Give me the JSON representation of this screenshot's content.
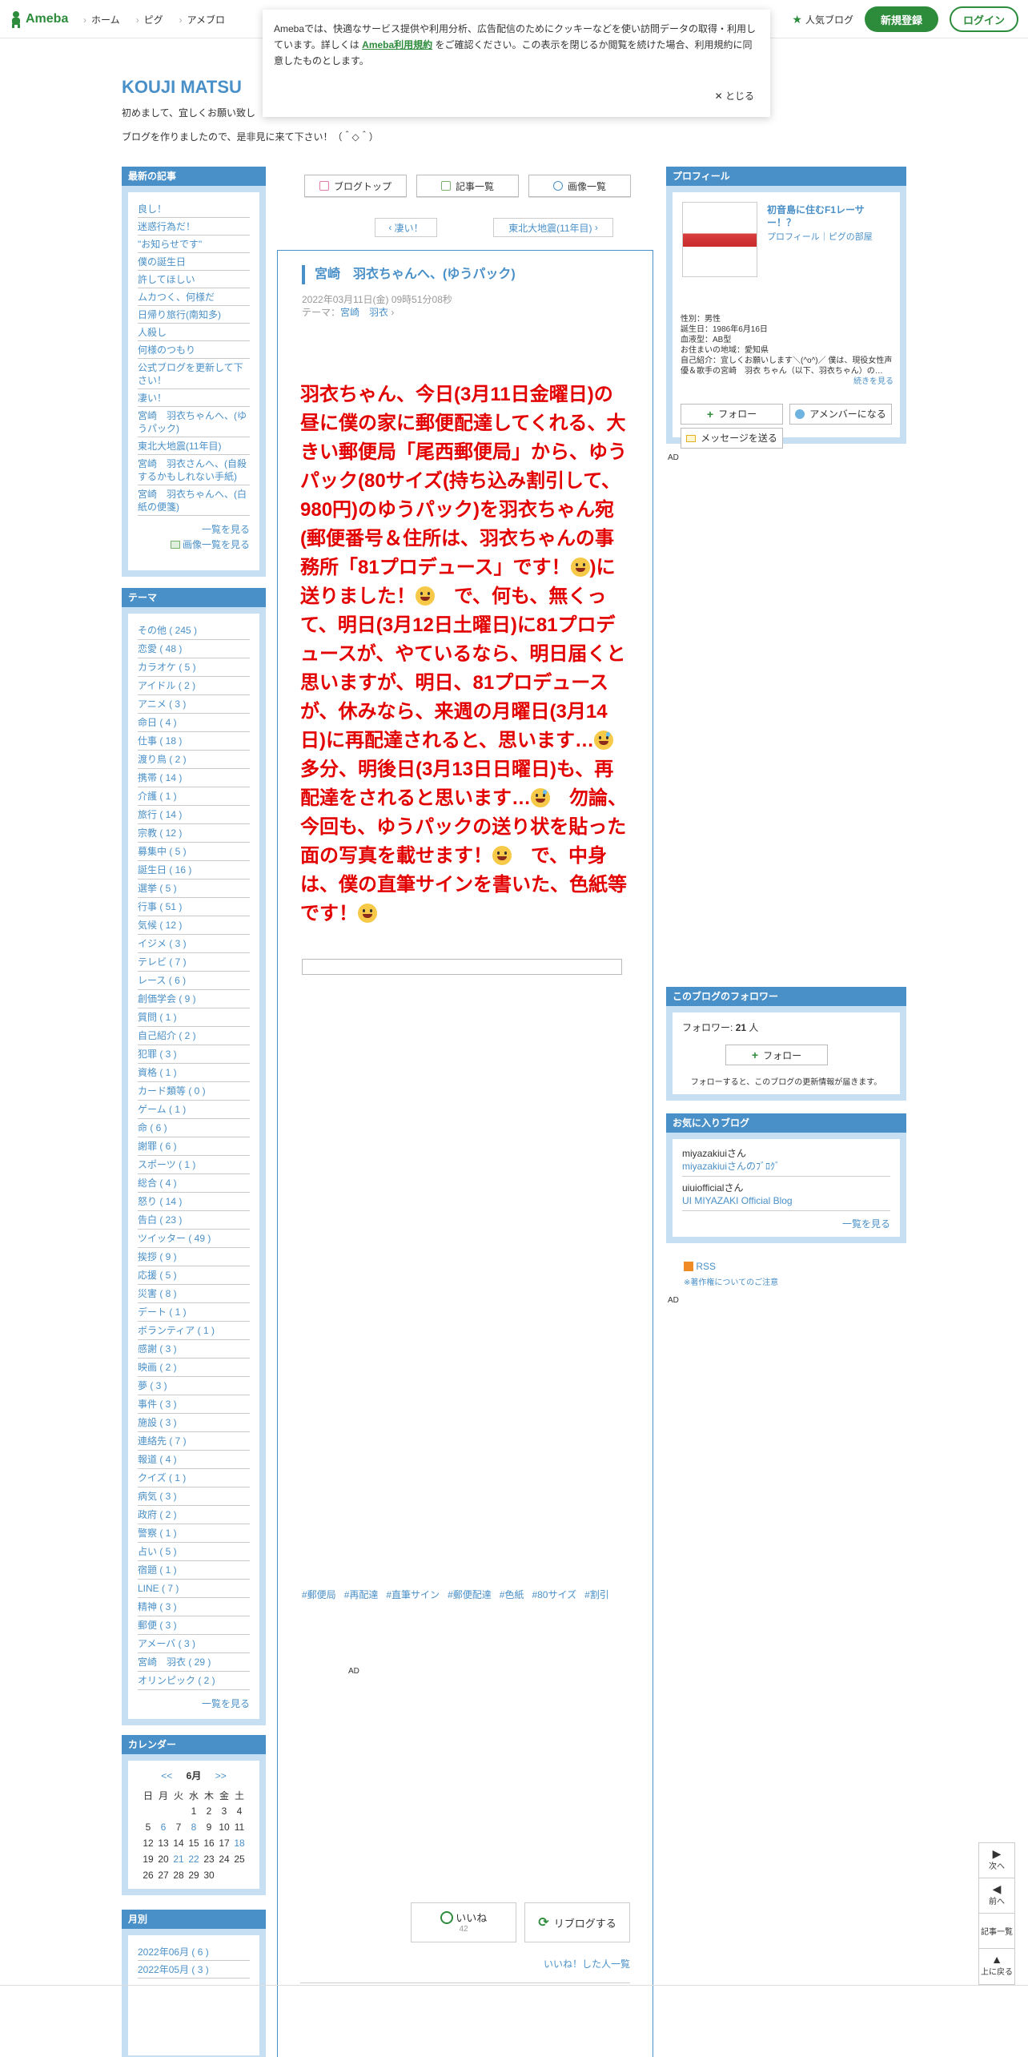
{
  "topbar": {
    "logo": "Ameba",
    "nav": [
      "ホーム",
      "ピグ",
      "アメブロ"
    ],
    "popular": "人気ブログ",
    "register": "新規登録",
    "login": "ログイン"
  },
  "cookie": {
    "text1": "Amebaでは、快適なサービス提供や利用分析、広告配信のためにクッキーなどを使い訪問データの取得・利用しています。詳しくは",
    "link": "Ameba利用規約",
    "text2": "をご確認ください。この表示を閉じるか閲覧を続けた場合、利用規約に同意したものとします。",
    "close": "とじる"
  },
  "blog": {
    "title": "KOUJI MATSU",
    "desc1": "初めまして、宜しくお願い致し",
    "desc2": "ブログを作りましたので、是非見に来て下さい！（＾◇＾）"
  },
  "recent": {
    "header": "最新の記事",
    "items": [
      "良し！",
      "迷惑行為だ！",
      "\"お知らせです\"",
      "僕の誕生日",
      "許してほしい",
      "ムカつく、何様だ",
      "日帰り旅行(南知多)",
      "人殺し",
      "何様のつもり",
      "公式ブログを更新して下さい！",
      "凄い！",
      "宮崎　羽衣ちゃんへ、(ゆうパック)",
      "東北大地震(11年目)",
      "宮崎　羽衣さんへ、(自殺するかもしれない手紙)",
      "宮崎　羽衣ちゃんへ、(白紙の便箋)"
    ],
    "more": "一覧を見る",
    "image_more": "画像一覧を見る"
  },
  "themes": {
    "header": "テーマ",
    "items": [
      "その他 ( 245 )",
      "恋愛 ( 48 )",
      "カラオケ ( 5 )",
      "アイドル ( 2 )",
      "アニメ ( 3 )",
      "命日 ( 4 )",
      "仕事 ( 18 )",
      "渡り鳥 ( 2 )",
      "携帯 ( 14 )",
      "介護 ( 1 )",
      "旅行 ( 14 )",
      "宗教 ( 12 )",
      "募集中 ( 5 )",
      "誕生日 ( 16 )",
      "選挙 ( 5 )",
      "行事 ( 51 )",
      "気候 ( 12 )",
      "イジメ ( 3 )",
      "テレビ ( 7 )",
      "レース ( 6 )",
      "創価学会 ( 9 )",
      "質問 ( 1 )",
      "自己紹介 ( 2 )",
      "犯罪 ( 3 )",
      "資格 ( 1 )",
      "カード類等 ( 0 )",
      "ゲーム ( 1 )",
      "命 ( 6 )",
      "謝罪 ( 6 )",
      "スポーツ ( 1 )",
      "総合 ( 4 )",
      "怒り ( 14 )",
      "告白 ( 23 )",
      "ツイッター ( 49 )",
      "挨拶 ( 9 )",
      "応援 ( 5 )",
      "災害 ( 8 )",
      "デート ( 1 )",
      "ボランティア ( 1 )",
      "感謝 ( 3 )",
      "映画 ( 2 )",
      "夢 ( 3 )",
      "事件 ( 3 )",
      "施設 ( 3 )",
      "連絡先 ( 7 )",
      "報道 ( 4 )",
      "クイズ ( 1 )",
      "病気 ( 3 )",
      "政府 ( 2 )",
      "警察 ( 1 )",
      "占い ( 5 )",
      "宿題 ( 1 )",
      "LINE ( 7 )",
      "精神 ( 3 )",
      "郵便 ( 3 )",
      "アメーバ ( 3 )",
      "宮崎　羽衣 ( 29 )",
      "オリンピック ( 2 )"
    ],
    "more": "一覧を見る"
  },
  "calendar": {
    "header": "カレンダー",
    "prev": "<<",
    "month": "6月",
    "next": ">>",
    "weekdays": [
      "日",
      "月",
      "火",
      "水",
      "木",
      "金",
      "土"
    ],
    "rows": [
      [
        "",
        "",
        "",
        "1",
        "2",
        "3",
        "4"
      ],
      [
        "5",
        "6",
        "7",
        "8",
        "9",
        "10",
        "11"
      ],
      [
        "12",
        "13",
        "14",
        "15",
        "16",
        "17",
        "18"
      ],
      [
        "19",
        "20",
        "21",
        "22",
        "23",
        "24",
        "25"
      ],
      [
        "26",
        "27",
        "28",
        "29",
        "30",
        "",
        ""
      ]
    ],
    "linked_days": [
      "6",
      "8",
      "18",
      "21",
      "22"
    ]
  },
  "monthly": {
    "header": "月別",
    "items": [
      "2022年06月 ( 6 )",
      "2022年05月 ( 3 )"
    ]
  },
  "center": {
    "tabs": [
      "ブログトップ",
      "記事一覧",
      "画像一覧"
    ],
    "prev": "凄い！",
    "next": "東北大地震(11年目)"
  },
  "article": {
    "title": "宮崎　羽衣ちゃんへ、(ゆうパック)",
    "date": "2022年03月11日(金) 09時51分08秒",
    "theme_label": "テーマ：",
    "theme": "宮崎　羽衣",
    "body_1": "羽衣ちゃん、今日(3月11日金曜日)の昼に僕の家に郵便配達してくれる、大きい郵便局「尾西郵便局」から、ゆうパック(80サイズ(持ち込み割引して、980円)のゆうパック)を羽衣ちゃん宛(郵便番号＆住所は、羽衣ちゃんの事務所「81プロデュース」です！",
    "body_2": ")に送りました！",
    "body_3": "　で、何も、無くって、明日(3月12日土曜日)に81プロデュースが、やているなら、明日届くと思いますが、明日、81プロデュースが、休みなら、来週の月曜日(3月14日)に再配達されると、思います…",
    "body_4": "　多分、明後日(3月13日日曜日)も、再配達をされると思います…",
    "body_5": "　勿論、今回も、ゆうパックの送り状を貼った面の写真を載せます！",
    "body_6": "　で、中身は、僕の直筆サインを書いた、色紙等です！",
    "tags": [
      "#郵便局",
      "#再配達",
      "#直筆サイン",
      "#郵便配達",
      "#色紙",
      "#80サイズ",
      "#割引"
    ],
    "ad": "AD",
    "like": "いいね",
    "like_count": "42",
    "reblog": "リブログする",
    "like_list": "いいね！した人一覧"
  },
  "profile": {
    "header": "プロフィール",
    "name": "初音島に住むF1レーサー！？",
    "links": "プロフィール｜ピグの部屋",
    "gender": "性別：男性",
    "birthday": "誕生日：1986年6月16日",
    "blood": "血液型：AB型",
    "area": "お住まいの地域：愛知県",
    "intro": "自己紹介：宜しくお願いします＼(^o^)／ 僕は、現役女性声優＆歌手の宮崎　羽衣 ちゃん（以下、羽衣ちゃん）の…",
    "read_more": "続きを見る",
    "follow": "フォロー",
    "member": "アメンバーになる",
    "message": "メッセージを送る"
  },
  "ad_label": "AD",
  "followers": {
    "header": "このブログのフォロワー",
    "label": "フォロワー:",
    "count": "21",
    "unit": "人",
    "follow": "フォロー",
    "note": "フォローすると、このブログの更新情報が届きます。"
  },
  "favorites": {
    "header": "お気に入りブログ",
    "items": [
      {
        "user": "miyazakiuiさん",
        "blog": "miyazakiuiさんのﾌﾞﾛｸﾞ"
      },
      {
        "user": "uiuiofficialさん",
        "blog": "UI MIYAZAKI Official Blog"
      }
    ],
    "more": "一覧を見る"
  },
  "rss": {
    "label": "RSS",
    "copyright": "※著作権についてのご注意"
  },
  "float_nav": {
    "next": "次へ",
    "prev": "前へ",
    "list": "記事一覧",
    "top": "上に戻る"
  }
}
